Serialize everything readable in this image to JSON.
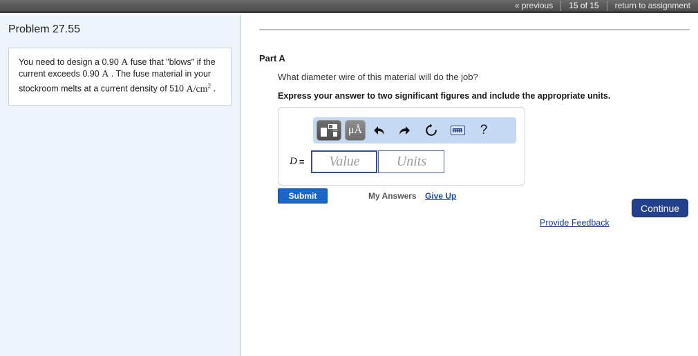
{
  "topnav": {
    "previous_label": "« previous",
    "page_count": "15 of 15",
    "return_label": "return to assignment"
  },
  "sidebar": {
    "problem_title": "Problem 27.55",
    "problem_text_part1": "You need to design a 0.90 ",
    "unit_a_1": "A",
    "problem_text_part2": " fuse that \"blows\" if the current exceeds 0.90 ",
    "unit_a_2": "A",
    "problem_text_part3": " . The fuse material in your stockroom melts at a current density of 510 ",
    "unit_density": "A/cm",
    "unit_density_exp": "2",
    "problem_text_part4": " ."
  },
  "main": {
    "part_label": "Part A",
    "question": "What diameter wire of this material will do the job?",
    "instruction": "Express your answer to two significant figures and include the appropriate units.",
    "toolbar": {
      "template_icon": "math-template-icon",
      "units_label": "μÅ",
      "undo_icon": "undo-arrow-icon",
      "redo_icon": "redo-arrow-icon",
      "reset_icon": "reset-refresh-icon",
      "keyboard_icon": "keyboard-icon",
      "help_label": "?"
    },
    "answer": {
      "variable": "D",
      "equals": "=",
      "value_placeholder": "Value",
      "units_placeholder": "Units",
      "value": "",
      "units": ""
    },
    "submit_label": "Submit",
    "my_answers_label": "My Answers",
    "give_up_label": "Give Up",
    "provide_feedback_label": "Provide Feedback",
    "continue_label": "Continue"
  },
  "colors": {
    "topbar": "#5b5b5b",
    "sidebar_bg": "#eef4fc",
    "toolbar_bg": "#c5daf2",
    "submit_blue": "#1967c8",
    "continue_navy": "#23408c",
    "link_blue": "#1a4fb0",
    "focus_border": "#2f4f9e"
  }
}
